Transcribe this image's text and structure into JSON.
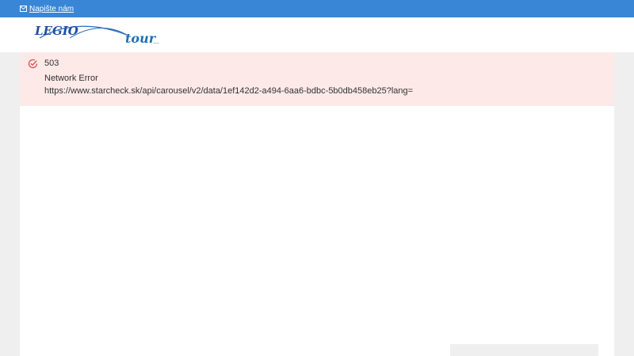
{
  "topbar": {
    "contact_label": "Napište nám",
    "contact_icon": "mail-icon",
    "background_color": "#3a86d6"
  },
  "header": {
    "logo": {
      "word1": "LEGIO",
      "word2": "tour",
      "suffix": "..."
    }
  },
  "alert": {
    "icon": "check-circle-icon",
    "code": "503",
    "title": "Network Error",
    "url": "https://www.starcheck.sk/api/carousel/v2/data/1ef142d2-a494-6aa6-bdbc-5b0db458eb25?lang=",
    "background_color": "#fce9e8",
    "icon_color": "#d9534f"
  }
}
